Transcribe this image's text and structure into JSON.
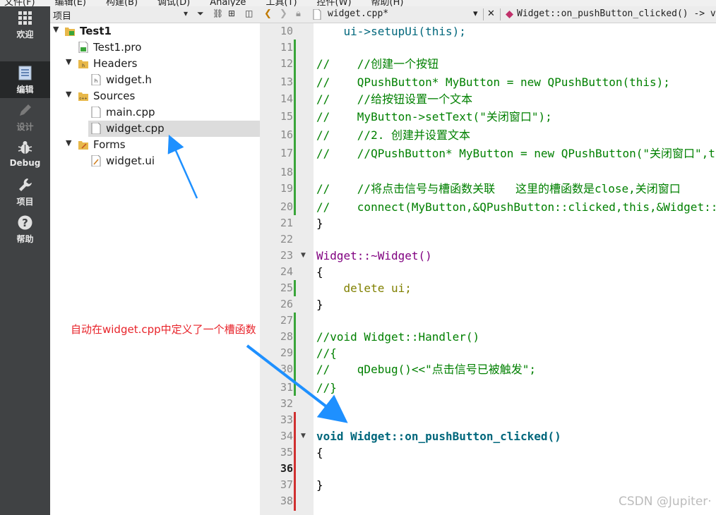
{
  "menubar": {
    "items": [
      "文件(F)",
      "编辑(E)",
      "构建(B)",
      "调试(D)",
      "Analyze",
      "工具(T)",
      "控件(W)",
      "帮助(H)"
    ]
  },
  "modes": [
    {
      "label": "欢迎",
      "icon": "grid-icon",
      "state": "normal"
    },
    {
      "label": "编辑",
      "icon": "document-icon",
      "state": "active"
    },
    {
      "label": "设计",
      "icon": "pencil-icon",
      "state": "disabled"
    },
    {
      "label": "Debug",
      "icon": "bug-icon",
      "state": "normal"
    },
    {
      "label": "项目",
      "icon": "wrench-icon",
      "state": "normal"
    },
    {
      "label": "帮助",
      "icon": "help-icon",
      "state": "normal"
    }
  ],
  "project_pane": {
    "title": "项目",
    "tree": [
      {
        "label": "Test1",
        "type": "project",
        "expanded": true
      },
      {
        "label": "Test1.pro",
        "type": "pro-file"
      },
      {
        "label": "Headers",
        "type": "folder",
        "expanded": true
      },
      {
        "label": "widget.h",
        "type": "header-file"
      },
      {
        "label": "Sources",
        "type": "folder",
        "expanded": true
      },
      {
        "label": "main.cpp",
        "type": "source-file"
      },
      {
        "label": "widget.cpp",
        "type": "source-file",
        "selected": true
      },
      {
        "label": "Forms",
        "type": "folder",
        "expanded": true
      },
      {
        "label": "widget.ui",
        "type": "form-file"
      }
    ]
  },
  "editor": {
    "file_tab": "widget.cpp*",
    "function_combo": "Widget::on_pushButton_clicked() -> void",
    "lines": [
      {
        "n": "10",
        "text": "    ui->setupUi(this);"
      },
      {
        "n": "11",
        "text": ""
      },
      {
        "n": "12",
        "text": "//    //创建一个按钮"
      },
      {
        "n": "13",
        "text": "//    QPushButton* MyButton = new QPushButton(this);"
      },
      {
        "n": "14",
        "text": "//    //给按钮设置一个文本"
      },
      {
        "n": "15",
        "text": "//    MyButton->setText(\"关闭窗口\");"
      },
      {
        "n": "16",
        "text": "//    //2. 创建并设置文本"
      },
      {
        "n": "17",
        "text": "//    //QPushButton* MyButton = new QPushButton(\"关闭窗口\",this);"
      },
      {
        "n": "18",
        "text": ""
      },
      {
        "n": "19",
        "text": "//    //将点击信号与槽函数关联   这里的槽函数是close,关闭窗口"
      },
      {
        "n": "20",
        "text": "//    connect(MyButton,&QPushButton::clicked,this,&Widget::close);"
      },
      {
        "n": "21",
        "text": "}"
      },
      {
        "n": "22",
        "text": ""
      },
      {
        "n": "23",
        "text": "Widget::~Widget()"
      },
      {
        "n": "24",
        "text": "{"
      },
      {
        "n": "25",
        "text": "    delete ui;"
      },
      {
        "n": "26",
        "text": "}"
      },
      {
        "n": "27",
        "text": ""
      },
      {
        "n": "28",
        "text": "//void Widget::Handler()"
      },
      {
        "n": "29",
        "text": "//{"
      },
      {
        "n": "30",
        "text": "//    qDebug()<<\"点击信号已被触发\";"
      },
      {
        "n": "31",
        "text": "//}"
      },
      {
        "n": "32",
        "text": ""
      },
      {
        "n": "33",
        "text": ""
      },
      {
        "n": "34",
        "text": "void Widget::on_pushButton_clicked()"
      },
      {
        "n": "35",
        "text": "{"
      },
      {
        "n": "36",
        "text": ""
      },
      {
        "n": "37",
        "text": "}"
      },
      {
        "n": "38",
        "text": ""
      }
    ]
  },
  "annotation": {
    "text": "自动在widget.cpp中定义了一个槽函数",
    "color": "#e8232a"
  },
  "arrow_color": "#1e90ff",
  "watermark": "CSDN @Jupiter·"
}
